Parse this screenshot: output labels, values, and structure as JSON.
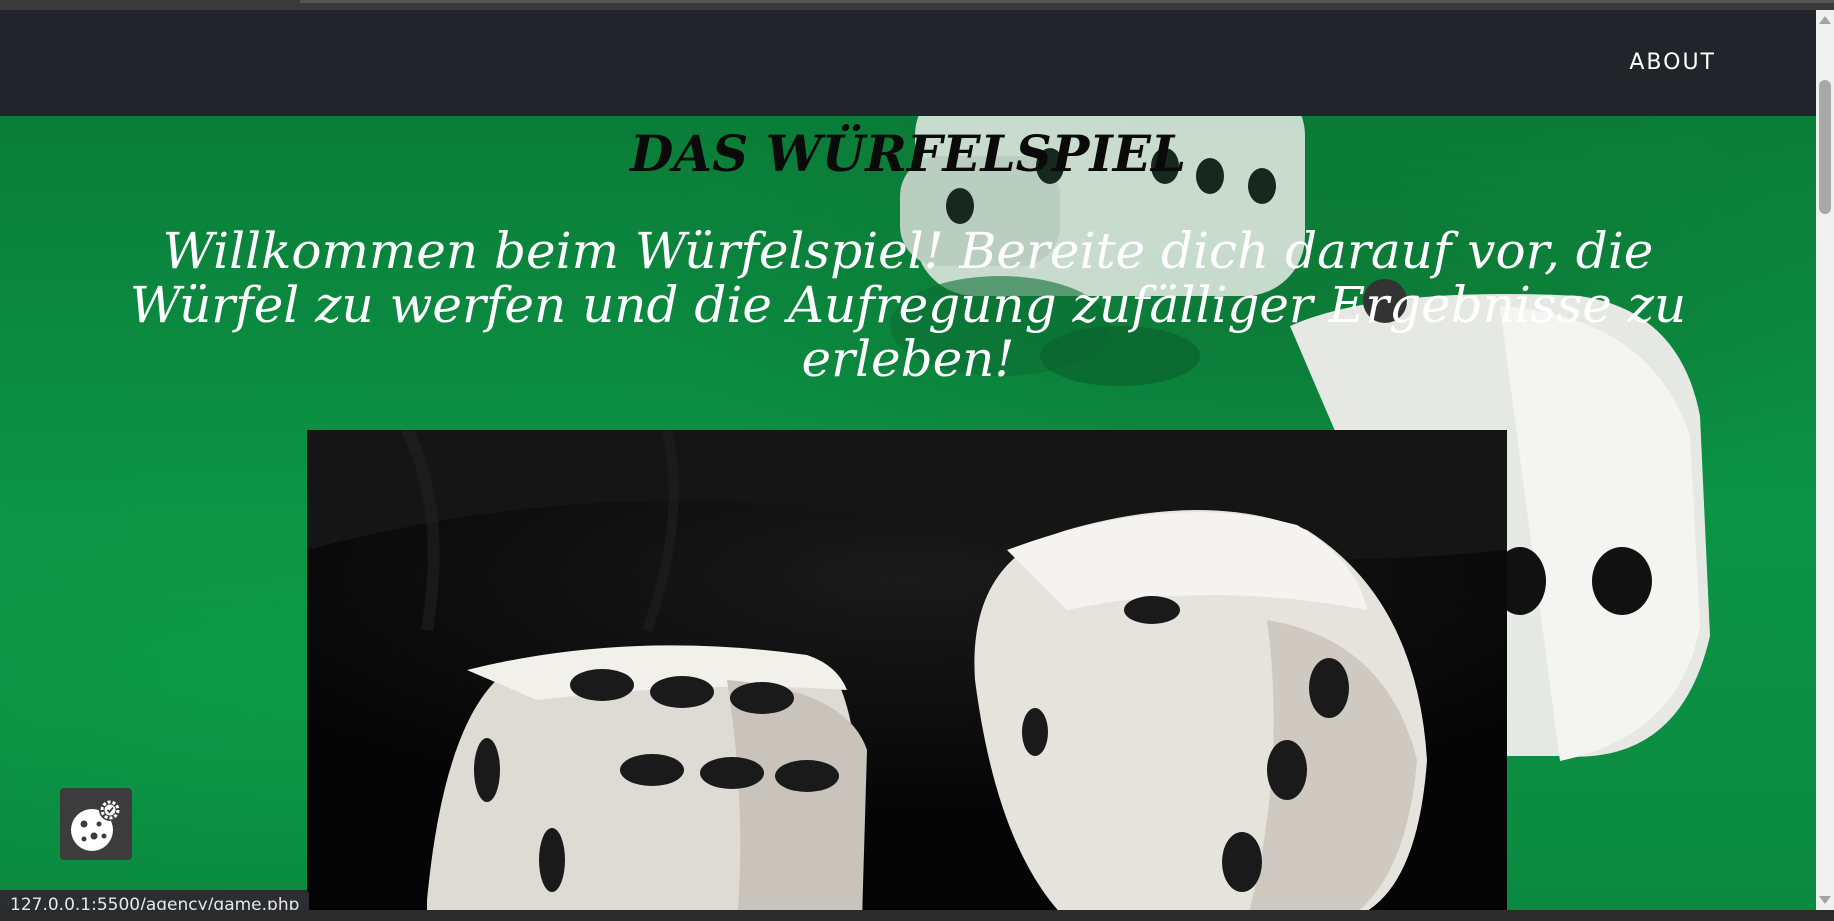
{
  "nav": {
    "about_label": "ABOUT"
  },
  "hero": {
    "title": "DAS WÜRFELSPIEL",
    "welcome": "Willkommen beim Würfelspiel! Bereite dich darauf vor, die Würfel zu werfen und die Aufregung zufälliger Ergebnisse zu erleben!"
  },
  "status_bar": {
    "url": "127.0.0.1:5500/agency/game.php"
  },
  "icons": {
    "cookie_settings": "cookie-settings-icon"
  },
  "colors": {
    "navbar_bg": "#212529",
    "hero_green": "#0a8a3c",
    "title_color": "#0a0a0a",
    "welcome_color": "#ffffff"
  }
}
